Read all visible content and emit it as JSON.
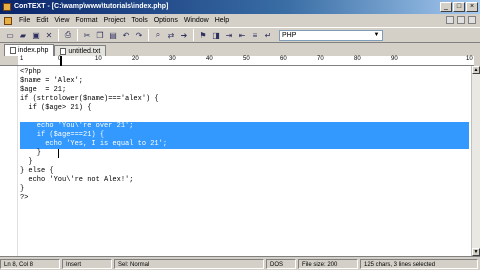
{
  "window": {
    "title": "ConTEXT - [C:\\wamp\\www\\tutorials\\index.php]",
    "controls": [
      "_",
      "□",
      "×"
    ]
  },
  "menu": {
    "items": [
      "File",
      "Edit",
      "View",
      "Format",
      "Project",
      "Tools",
      "Options",
      "Window",
      "Help"
    ]
  },
  "toolbar": {
    "icons": [
      "new-file-icon",
      "open-icon",
      "save-icon",
      "close-icon",
      "print-icon",
      "cut-icon",
      "copy-icon",
      "paste-icon",
      "undo-icon",
      "redo-icon",
      "find-icon",
      "replace-icon",
      "goto-icon",
      "find-next-icon",
      "bookmark-icon",
      "indent-icon",
      "outdent-icon",
      "comment-icon",
      "wordwrap-icon"
    ],
    "syntax_value": "PHP"
  },
  "tabs": [
    {
      "label": "index.php"
    },
    {
      "label": "untitled.txt"
    }
  ],
  "ruler": {
    "ticks": [
      "1",
      "0",
      "10",
      "20",
      "30",
      "40",
      "50",
      "60",
      "70",
      "80",
      "90",
      "10"
    ]
  },
  "code": {
    "lines": [
      "<?php",
      "$name = 'Alex';",
      "$age  = 21;",
      "if (strtolower($name)==='alex') {",
      "  if ($age> 21) {",
      "    echo 'You\\'re over 21';",
      "    if ($age===21) {",
      "      echo 'Yes, I is equal to 21';",
      "    }",
      "  }",
      "} else {",
      "  echo 'You\\'re not Alex!';",
      "}",
      "?>"
    ],
    "selected_lines": [
      5,
      6,
      7
    ]
  },
  "status": {
    "position": "Ln 8, Col 8",
    "mode": "Insert",
    "format": "Sel: Normal",
    "encoding": "DOS",
    "filesize": "File size: 200",
    "selection": "125 chars, 3 lines selected"
  }
}
